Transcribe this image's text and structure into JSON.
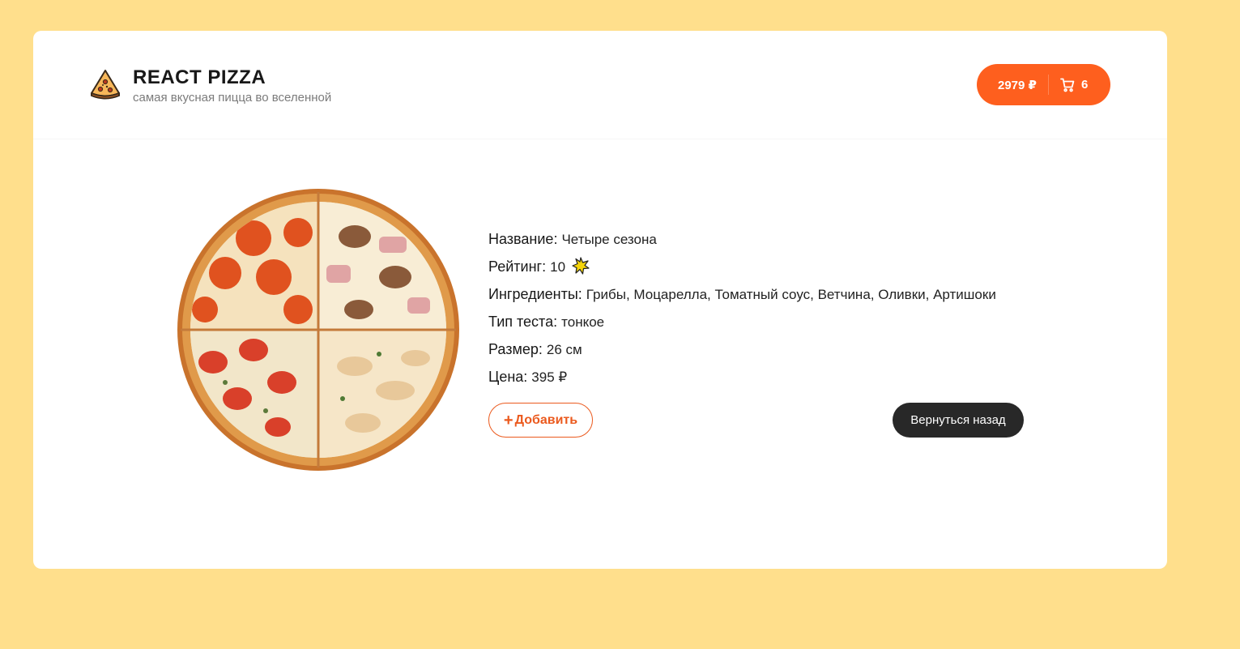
{
  "header": {
    "logo_title": "REACT PIZZA",
    "logo_subtitle": "самая вкусная пицца во вселенной",
    "logo_icon": "pizza-slice-icon",
    "cart": {
      "price": "2979 ₽",
      "count": "6",
      "icon": "cart-icon"
    }
  },
  "pizza": {
    "image_icon": "pizza-image",
    "name_label": "Название:",
    "name": "Четыре сезона",
    "rating_label": "Рейтинг:",
    "rating": "10",
    "rating_icon": "star-icon",
    "ingredients_label": "Ингредиенты:",
    "ingredients": "Грибы, Моцарелла, Томатный соус, Ветчина, Оливки, Артишоки",
    "dough_label": "Тип теста:",
    "dough": "тонкое",
    "size_label": "Размер:",
    "size": "26 см",
    "price_label": "Цена:",
    "price": "395 ₽"
  },
  "actions": {
    "add_plus": "+",
    "add_label": "Добавить",
    "back_label": "Вернуться назад"
  },
  "colors": {
    "background": "#ffdf8c",
    "accent": "#fe5f1e",
    "dark_button": "#282828"
  }
}
